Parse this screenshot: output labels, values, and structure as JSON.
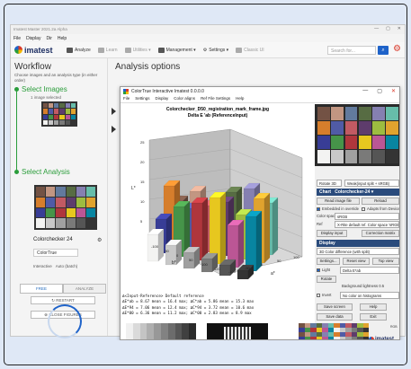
{
  "app": {
    "window_title": "Imatest Master 2021.2a Alpha",
    "menu": [
      "File",
      "Display",
      "Dir",
      "Help"
    ],
    "window_buttons": [
      "—",
      "▢",
      "✕"
    ]
  },
  "toolbar": {
    "logo": "imatest",
    "items": [
      {
        "label": "Analyze",
        "icon": "analyze-icon",
        "dim": false
      },
      {
        "label": "Learn",
        "icon": "learn-icon",
        "dim": true
      },
      {
        "label": "Utilities ▾",
        "icon": "utilities-icon",
        "dim": true
      },
      {
        "label": "Management ▾",
        "icon": "management-icon",
        "dim": false
      },
      {
        "label": "Settings ▾",
        "icon": "gear-icon",
        "dim": false
      },
      {
        "label": "Classic UI",
        "icon": "classic-ui-icon",
        "dim": true
      }
    ],
    "search_placeholder": "Search for..."
  },
  "workflow": {
    "title": "Workflow",
    "subtitle": "Choose images and an analysis type (in either order)",
    "step1": "Select Images",
    "step1_caption": "1 image selected",
    "step2": "Select Analysis",
    "analysis_name": "Colorchecker 24",
    "analysis_option": "ColorTrue",
    "interactive_label": "Interactive",
    "auto_label": "Auto (batch)",
    "tabs": [
      "FREE",
      "ANALYZE"
    ],
    "restart": "↻ RESTART",
    "close_figures": "⊗ CLOSE FIGURES"
  },
  "main": {
    "title": "Analysis options"
  },
  "dialog": {
    "title": "ColorTrue Interactive  Imatest 0.0.0.0",
    "menu": [
      "File",
      "Settings",
      "Display",
      "Color aligns",
      "Ref File Settings",
      "Help"
    ],
    "window_buttons": [
      "—",
      "▢",
      "✕"
    ],
    "plot_title_1": "Colorchecker_D50_registration_mark_frame.jpg",
    "plot_title_2": "Delta E 'ab  (ReferenceInput)",
    "stats": [
      "Δ<Input-Reference>  Default reference",
      "ΔE*ab = 8.67 mean = 16.4 max; ΔC*ab = 5.86 mean = 15.3 max",
      "ΔE*94 = 7.06 mean = 12.4 max; ΔC*94 = 3.72 mean = 10.6 max",
      "ΔE*00 = 6.36 mean = 11.2 max; ΔC*00 = 2.83 mean = 8.9 max"
    ],
    "right_panel": {
      "rotate_sel": "Rotate 3D",
      "view_sel": "Weak(input split + sRGB)",
      "chart_label": "Chart",
      "chart_name": "Colorchecker-24",
      "read_image_file": "Read image file",
      "reload": "Reload",
      "embedded_profile": "Embedded in override",
      "adapt_device": "Adapts from Device",
      "color_space_label": "Color space",
      "color_space": "sRGB",
      "ref_label": "Ref",
      "ref_value": "X-Rite default ref. Color space 'sRGB'",
      "display_input": "Display input",
      "correction_matrix": "Correction matrix",
      "display_label": "Display",
      "display_value": "3D Color difference (with split)",
      "settings": "Settings...",
      "reset_view": "Reset view",
      "top_view": "Top view",
      "light_label": "Light",
      "light_value": "Delta E*ab",
      "rotate_btn": "Rotate",
      "bg_lightness": "Background lightness",
      "bg_lightness_value": "0.5",
      "invert_label": "Invert",
      "invert_value": "No color on histograms",
      "save_screen": "Save screen",
      "help": "Help",
      "save_data": "Save data",
      "exit": "Exit",
      "rgb_label": "RGB",
      "brand": "imatest"
    },
    "axis_labels": {
      "ticks_z": [
        "25",
        "20",
        "15",
        "10",
        "5"
      ],
      "ticks_x": [
        "-100",
        "-50",
        "0",
        "50",
        "100"
      ],
      "ticks_y": [
        "-100",
        "-50",
        "0",
        "50",
        "100",
        "120"
      ],
      "xlabel": "a*",
      "ylabel": "b*",
      "zlabel": "L*"
    }
  },
  "colors": {
    "accent_blue": "#1f63c9",
    "brand_navy": "#1d2e62",
    "step_green": "#2a9d3a",
    "close_red": "#d93a2b",
    "bg": "#dfe8f6"
  },
  "colorchecker": [
    "#735244",
    "#c29682",
    "#627a9d",
    "#576c43",
    "#8580b1",
    "#67bdaa",
    "#d67e2c",
    "#505ba6",
    "#c15a63",
    "#5e3c6c",
    "#9dbc40",
    "#e0a32e",
    "#383d96",
    "#469449",
    "#af363c",
    "#e7c71f",
    "#bb5695",
    "#0885a1",
    "#f3f3f2",
    "#c8c8c8",
    "#a0a0a0",
    "#7a7a79",
    "#555555",
    "#343434"
  ]
}
